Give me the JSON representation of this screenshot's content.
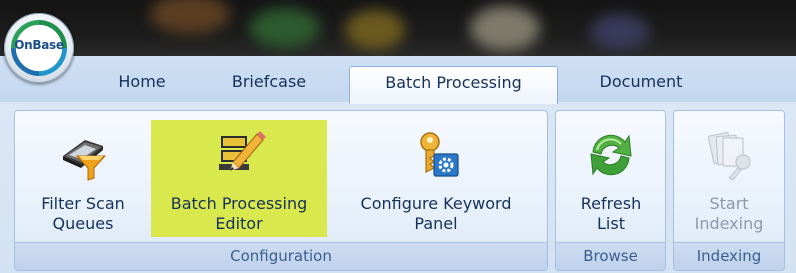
{
  "app": {
    "logo_text": "OnBase"
  },
  "tabs": [
    {
      "label": "Home",
      "active": false
    },
    {
      "label": "Briefcase",
      "active": false
    },
    {
      "label": "Batch Processing",
      "active": true
    },
    {
      "label": "Document",
      "active": false
    }
  ],
  "groups": {
    "configuration": {
      "label": "Configuration",
      "buttons": [
        {
          "line1": "Filter Scan",
          "line2": "Queues",
          "icon": "scanner-filter-icon",
          "enabled": true,
          "highlighted": false
        },
        {
          "line1": "Batch Processing",
          "line2": "Editor",
          "icon": "edit-pencil-icon",
          "enabled": true,
          "highlighted": true
        },
        {
          "line1": "Configure Keyword",
          "line2": "Panel",
          "icon": "key-settings-icon",
          "enabled": true,
          "highlighted": false
        }
      ]
    },
    "browse": {
      "label": "Browse",
      "buttons": [
        {
          "line1": "Refresh",
          "line2": "List",
          "icon": "refresh-icon",
          "enabled": true,
          "highlighted": false
        }
      ]
    },
    "indexing": {
      "label": "Indexing",
      "buttons": [
        {
          "line1": "Start",
          "line2": "Indexing",
          "icon": "start-indexing-icon",
          "enabled": false,
          "highlighted": false
        }
      ]
    }
  },
  "colors": {
    "highlight": "#d9e84c",
    "text": "#15315a",
    "disabled_text": "#8d9aab",
    "tab_strip": "#cfe0f4"
  }
}
